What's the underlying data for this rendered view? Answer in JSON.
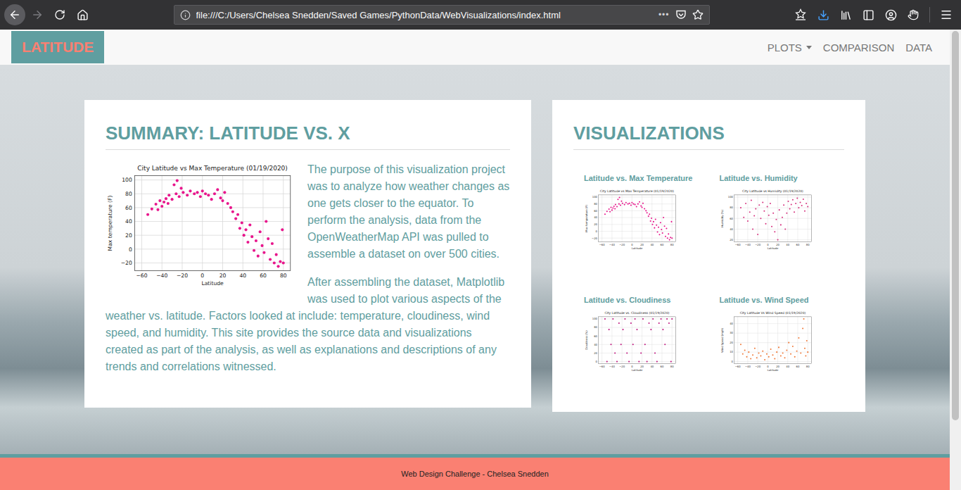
{
  "browser": {
    "url": "file:///C:/Users/Chelsea Snedden/Saved Games/PythonData/WebVisualizations/index.html",
    "more": "•••",
    "history": {
      "can_go_back": true,
      "can_go_forward": false
    },
    "download": {
      "active": true
    }
  },
  "navbar": {
    "brand": "LATITUDE",
    "links": [
      {
        "label": "PLOTS",
        "dropdown": true
      },
      {
        "label": "COMPARISON",
        "dropdown": false
      },
      {
        "label": "DATA",
        "dropdown": false
      }
    ]
  },
  "summary": {
    "title": "SUMMARY: LATITUDE VS. X",
    "chart": {
      "title": "City Latitude vs Max Temperature (01/19/2020)",
      "x_label": "Latitude",
      "y_label": "Max temperature (F)",
      "color": "#e8168c",
      "x_ticks": [
        "−60",
        "−40",
        "−20",
        "0",
        "20",
        "40",
        "60",
        "80"
      ],
      "y_ticks": [
        "−20",
        "0",
        "20",
        "40",
        "60",
        "80",
        "100"
      ],
      "points": [
        [
          -54,
          50
        ],
        [
          -50,
          58
        ],
        [
          -46,
          65
        ],
        [
          -44,
          57
        ],
        [
          -42,
          70
        ],
        [
          -40,
          62
        ],
        [
          -38,
          68
        ],
        [
          -36,
          73
        ],
        [
          -34,
          66
        ],
        [
          -33,
          78
        ],
        [
          -30,
          72
        ],
        [
          -28,
          93
        ],
        [
          -26,
          80
        ],
        [
          -25,
          99
        ],
        [
          -23,
          76
        ],
        [
          -21,
          88
        ],
        [
          -19,
          82
        ],
        [
          -15,
          78
        ],
        [
          -12,
          84
        ],
        [
          -8,
          80
        ],
        [
          -5,
          82
        ],
        [
          -2,
          76
        ],
        [
          0,
          84
        ],
        [
          3,
          80
        ],
        [
          6,
          78
        ],
        [
          9,
          72
        ],
        [
          12,
          80
        ],
        [
          15,
          86
        ],
        [
          18,
          74
        ],
        [
          20,
          70
        ],
        [
          22,
          82
        ],
        [
          25,
          66
        ],
        [
          28,
          60
        ],
        [
          30,
          54
        ],
        [
          33,
          44
        ],
        [
          35,
          50
        ],
        [
          37,
          30
        ],
        [
          39,
          38
        ],
        [
          41,
          20
        ],
        [
          43,
          28
        ],
        [
          45,
          10
        ],
        [
          47,
          35
        ],
        [
          49,
          18
        ],
        [
          51,
          -2
        ],
        [
          53,
          12
        ],
        [
          55,
          -10
        ],
        [
          57,
          25
        ],
        [
          59,
          5
        ],
        [
          61,
          -5
        ],
        [
          63,
          40
        ],
        [
          65,
          15
        ],
        [
          67,
          -15
        ],
        [
          69,
          8
        ],
        [
          71,
          -20
        ],
        [
          73,
          -8
        ],
        [
          75,
          -25
        ],
        [
          77,
          -18
        ],
        [
          79,
          28
        ],
        [
          80,
          -20
        ]
      ]
    },
    "paragraphs": [
      "The purpose of this visualization project was to analyze how weather changes as one gets closer to the equator. To perform the analysis, data from the OpenWeatherMap API was pulled to assemble a dataset on over 500 cities.",
      "After assembling the dataset, Matplotlib was used to plot various aspects of the weather vs. latitude. Factors looked at include: temperature, cloudiness, wind speed, and humidity. This site provides the source data and visualizations created as part of the analysis, as well as explanations and descriptions of any trends and correlations witnessed."
    ]
  },
  "visualizations": {
    "title": "VISUALIZATIONS",
    "items": [
      {
        "label": "Latitude vs. Max Temperature",
        "color": "#e8168c",
        "chart": {
          "title": "City Latitude vs Max Temperature (01/19/2020)",
          "x_label": "Latitude",
          "y_label": "Max temperature (F)",
          "x_ticks": [
            "−60",
            "−40",
            "−20",
            "0",
            "20",
            "40",
            "60",
            "80"
          ],
          "y_ticks": [
            "−20",
            "0",
            "20",
            "40",
            "60",
            "80",
            "100"
          ],
          "points": [
            [
              -54,
              50
            ],
            [
              -50,
              58
            ],
            [
              -46,
              65
            ],
            [
              -44,
              57
            ],
            [
              -42,
              70
            ],
            [
              -40,
              62
            ],
            [
              -38,
              68
            ],
            [
              -36,
              73
            ],
            [
              -34,
              66
            ],
            [
              -33,
              78
            ],
            [
              -30,
              72
            ],
            [
              -28,
              93
            ],
            [
              -26,
              80
            ],
            [
              -25,
              99
            ],
            [
              -23,
              76
            ],
            [
              -21,
              88
            ],
            [
              -19,
              82
            ],
            [
              -15,
              78
            ],
            [
              -12,
              84
            ],
            [
              -8,
              80
            ],
            [
              -5,
              82
            ],
            [
              -2,
              76
            ],
            [
              0,
              84
            ],
            [
              3,
              80
            ],
            [
              6,
              78
            ],
            [
              9,
              72
            ],
            [
              12,
              80
            ],
            [
              15,
              86
            ],
            [
              18,
              74
            ],
            [
              20,
              70
            ],
            [
              22,
              82
            ],
            [
              25,
              66
            ],
            [
              28,
              60
            ],
            [
              30,
              54
            ],
            [
              33,
              44
            ],
            [
              35,
              50
            ],
            [
              37,
              30
            ],
            [
              39,
              38
            ],
            [
              41,
              20
            ],
            [
              43,
              28
            ],
            [
              45,
              10
            ],
            [
              47,
              35
            ],
            [
              49,
              18
            ],
            [
              51,
              -2
            ],
            [
              53,
              12
            ],
            [
              55,
              -10
            ],
            [
              57,
              25
            ],
            [
              59,
              5
            ],
            [
              61,
              -5
            ],
            [
              63,
              40
            ],
            [
              65,
              15
            ],
            [
              67,
              -15
            ],
            [
              69,
              8
            ],
            [
              71,
              -20
            ],
            [
              73,
              -8
            ],
            [
              75,
              -25
            ],
            [
              77,
              -18
            ],
            [
              79,
              28
            ],
            [
              80,
              -20
            ]
          ]
        }
      },
      {
        "label": "Latitude vs. Humidity",
        "color": "#d6337f",
        "chart": {
          "title": "City Latitude vs Humidity (01/19/2020)",
          "x_label": "Latitude",
          "y_label": "Humidity (%)",
          "x_ticks": [
            "−60",
            "−40",
            "−20",
            "0",
            "20",
            "40",
            "60",
            "80"
          ],
          "y_ticks": [
            "20",
            "40",
            "60",
            "80",
            "100"
          ],
          "points": [
            [
              -54,
              80
            ],
            [
              -48,
              62
            ],
            [
              -44,
              88
            ],
            [
              -40,
              55
            ],
            [
              -36,
              72
            ],
            [
              -33,
              94
            ],
            [
              -30,
              40
            ],
            [
              -27,
              65
            ],
            [
              -24,
              78
            ],
            [
              -20,
              30
            ],
            [
              -17,
              85
            ],
            [
              -14,
              60
            ],
            [
              -10,
              90
            ],
            [
              -7,
              74
            ],
            [
              -4,
              50
            ],
            [
              -1,
              82
            ],
            [
              2,
              66
            ],
            [
              5,
              88
            ],
            [
              8,
              45
            ],
            [
              11,
              70
            ],
            [
              14,
              35
            ],
            [
              17,
              58
            ],
            [
              20,
              20
            ],
            [
              23,
              76
            ],
            [
              26,
              48
            ],
            [
              29,
              62
            ],
            [
              32,
              85
            ],
            [
              35,
              40
            ],
            [
              38,
              70
            ],
            [
              41,
              92
            ],
            [
              44,
              78
            ],
            [
              47,
              86
            ],
            [
              50,
              95
            ],
            [
              53,
              72
            ],
            [
              56,
              88
            ],
            [
              59,
              98
            ],
            [
              62,
              80
            ],
            [
              65,
              90
            ],
            [
              68,
              84
            ],
            [
              71,
              96
            ],
            [
              74,
              74
            ],
            [
              77,
              88
            ],
            [
              80,
              82
            ]
          ]
        }
      },
      {
        "label": "Latitude vs. Cloudiness",
        "color": "#c0157f",
        "chart": {
          "title": "City Latitude vs. Cloudiness (01/19/2020)",
          "x_label": "Latitude",
          "y_label": "Cloudiness (%)",
          "x_ticks": [
            "−60",
            "−40",
            "−20",
            "0",
            "20",
            "40",
            "60",
            "80"
          ],
          "y_ticks": [
            "0",
            "20",
            "40",
            "60",
            "80",
            "100"
          ],
          "points": [
            [
              -54,
              100
            ],
            [
              -50,
              0
            ],
            [
              -46,
              75
            ],
            [
              -42,
              40
            ],
            [
              -38,
              100
            ],
            [
              -34,
              20
            ],
            [
              -30,
              0
            ],
            [
              -26,
              90
            ],
            [
              -22,
              40
            ],
            [
              -18,
              75
            ],
            [
              -14,
              100
            ],
            [
              -10,
              20
            ],
            [
              -6,
              0
            ],
            [
              -2,
              90
            ],
            [
              2,
              40
            ],
            [
              6,
              100
            ],
            [
              10,
              75
            ],
            [
              14,
              0
            ],
            [
              18,
              20
            ],
            [
              22,
              100
            ],
            [
              26,
              40
            ],
            [
              30,
              0
            ],
            [
              34,
              90
            ],
            [
              38,
              75
            ],
            [
              42,
              100
            ],
            [
              46,
              20
            ],
            [
              50,
              0
            ],
            [
              54,
              90
            ],
            [
              58,
              100
            ],
            [
              62,
              75
            ],
            [
              66,
              40
            ],
            [
              70,
              100
            ],
            [
              74,
              90
            ],
            [
              78,
              0
            ],
            [
              80,
              100
            ]
          ]
        }
      },
      {
        "label": "Latitude vs. Wind Speed",
        "color": "#f07a3a",
        "chart": {
          "title": "City Latitude Vs Wind Speed (01/19/2020)",
          "x_label": "Latitude",
          "y_label": "Wind Speed (mph)",
          "x_ticks": [
            "−60",
            "−40",
            "−20",
            "0",
            "20",
            "40",
            "60",
            "80"
          ],
          "y_ticks": [
            "0",
            "10",
            "20",
            "30",
            "40"
          ],
          "points": [
            [
              -54,
              18
            ],
            [
              -50,
              8
            ],
            [
              -46,
              12
            ],
            [
              -42,
              5
            ],
            [
              -38,
              10
            ],
            [
              -34,
              3
            ],
            [
              -30,
              7
            ],
            [
              -26,
              14
            ],
            [
              -22,
              4
            ],
            [
              -18,
              9
            ],
            [
              -14,
              6
            ],
            [
              -10,
              11
            ],
            [
              -6,
              2
            ],
            [
              -2,
              8
            ],
            [
              2,
              5
            ],
            [
              6,
              13
            ],
            [
              10,
              7
            ],
            [
              14,
              3
            ],
            [
              18,
              10
            ],
            [
              22,
              15
            ],
            [
              26,
              6
            ],
            [
              30,
              9
            ],
            [
              34,
              4
            ],
            [
              38,
              12
            ],
            [
              42,
              20
            ],
            [
              46,
              8
            ],
            [
              50,
              16
            ],
            [
              54,
              5
            ],
            [
              58,
              11
            ],
            [
              62,
              25
            ],
            [
              66,
              9
            ],
            [
              70,
              35
            ],
            [
              72,
              45
            ],
            [
              74,
              14
            ],
            [
              76,
              6
            ],
            [
              78,
              22
            ],
            [
              80,
              10
            ]
          ]
        }
      }
    ]
  },
  "footer": "Web Design Challenge - Chelsea Snedden",
  "scrollbar": {
    "level": 0.85
  }
}
